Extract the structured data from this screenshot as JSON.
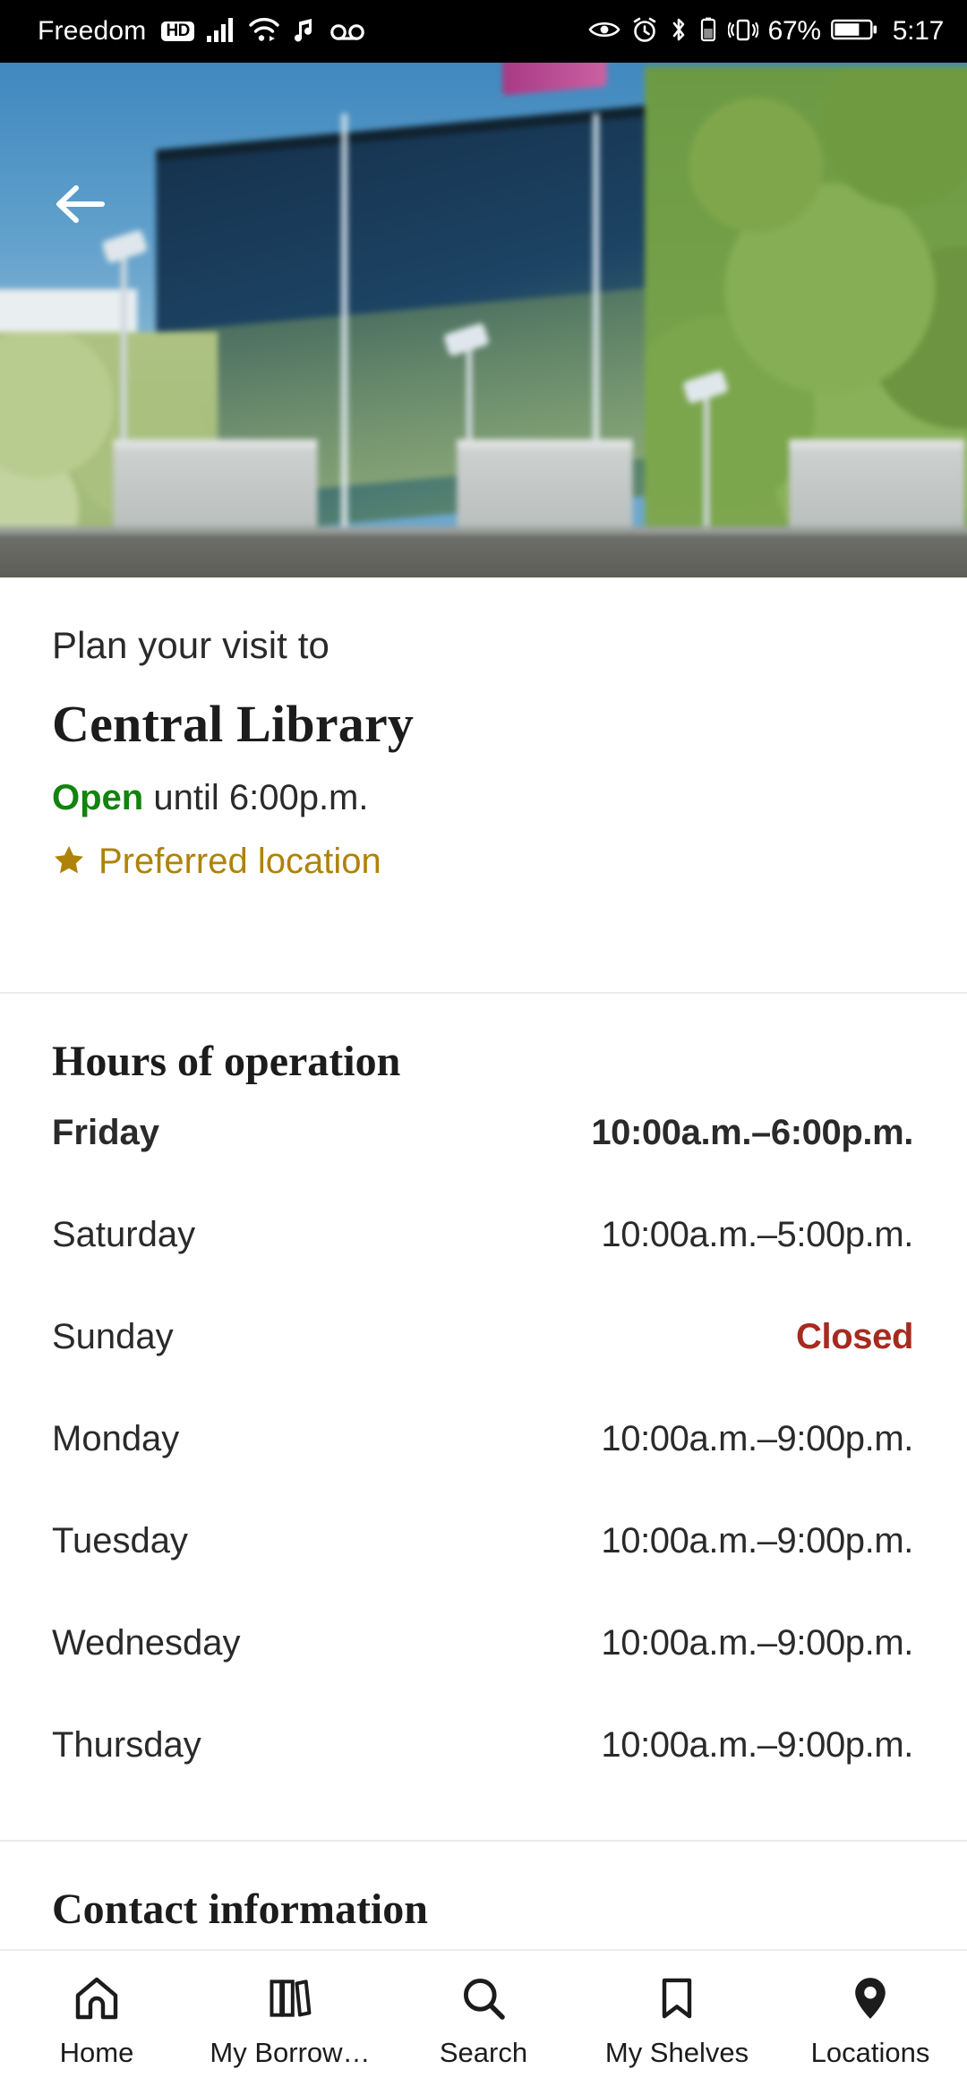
{
  "status_bar": {
    "carrier": "Freedom",
    "hd_badge": "HD",
    "battery_percent": "67%",
    "time": "5:17",
    "left_icons": [
      "hd-badge-icon",
      "signal-bars-icon",
      "wifi-icon",
      "music-note-icon",
      "voicemail-icon"
    ],
    "right_icons": [
      "eye-icon",
      "alarm-clock-icon",
      "bluetooth-icon",
      "bluetooth-battery-icon",
      "vibrate-icon",
      "battery-icon"
    ]
  },
  "hero": {
    "back_icon": "back-arrow-icon",
    "photo_description": "Central Library exterior"
  },
  "intro": {
    "plan_visit": "Plan your visit to",
    "library_name": "Central Library",
    "open_word": "Open",
    "open_rest": " until 6:00p.m.",
    "preferred_label": "Preferred location",
    "star_icon": "star-icon"
  },
  "hours": {
    "heading": "Hours of operation",
    "rows": [
      {
        "day": "Friday",
        "value": "10:00a.m.–6:00p.m.",
        "today": true,
        "closed": false
      },
      {
        "day": "Saturday",
        "value": "10:00a.m.–5:00p.m.",
        "today": false,
        "closed": false
      },
      {
        "day": "Sunday",
        "value": "Closed",
        "today": false,
        "closed": true
      },
      {
        "day": "Monday",
        "value": "10:00a.m.–9:00p.m.",
        "today": false,
        "closed": false
      },
      {
        "day": "Tuesday",
        "value": "10:00a.m.–9:00p.m.",
        "today": false,
        "closed": false
      },
      {
        "day": "Wednesday",
        "value": "10:00a.m.–9:00p.m.",
        "today": false,
        "closed": false
      },
      {
        "day": "Thursday",
        "value": "10:00a.m.–9:00p.m.",
        "today": false,
        "closed": false
      }
    ]
  },
  "contact": {
    "heading": "Contact information"
  },
  "bottom_nav": {
    "items": [
      {
        "label": "Home",
        "icon": "home-icon",
        "active": false
      },
      {
        "label": "My Borrow…",
        "icon": "books-icon",
        "active": false
      },
      {
        "label": "Search",
        "icon": "search-icon",
        "active": false
      },
      {
        "label": "My Shelves",
        "icon": "bookmark-icon",
        "active": false
      },
      {
        "label": "Locations",
        "icon": "location-pin-icon",
        "active": true
      }
    ]
  },
  "colors": {
    "open_green": "#13830F",
    "closed_red": "#A62B1F",
    "preferred_gold": "#AF8209",
    "text_primary": "#1c1c1c",
    "divider": "#ececec"
  }
}
